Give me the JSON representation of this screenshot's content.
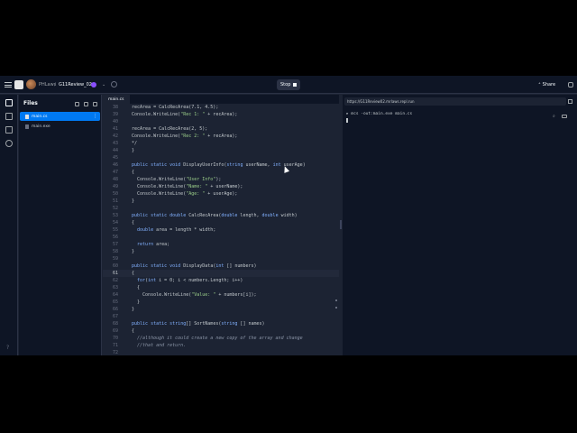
{
  "header": {
    "user": "PHLaws",
    "separator": "/",
    "repl": "G11Review_02",
    "chevron": "⌄",
    "stop_label": "Stop",
    "share_label": "Share",
    "share_icon": "person-plus-icon"
  },
  "files": {
    "title": "Files",
    "items": [
      {
        "name": "main.cs",
        "active": true
      },
      {
        "name": "main.exe",
        "active": false
      }
    ],
    "more": "⋮"
  },
  "editor": {
    "tab": "main.cs",
    "current_line": 61,
    "lines": [
      {
        "n": "38",
        "t": "recArea = CalcRecArea(7.1, 4.5);"
      },
      {
        "n": "39",
        "t": "Console.WriteLine(\"Rec 1: \" + recArea);"
      },
      {
        "n": "40",
        "t": ""
      },
      {
        "n": "41",
        "t": "recArea = CalcRecArea(2, 5);"
      },
      {
        "n": "42",
        "t": "Console.WriteLine(\"Rec 2: \" + recArea);"
      },
      {
        "n": "43",
        "t": "*/"
      },
      {
        "n": "44",
        "t": "}"
      },
      {
        "n": "45",
        "t": ""
      },
      {
        "n": "46",
        "t": "public static void DisplayUserInfo(string userName, int userAge)"
      },
      {
        "n": "47",
        "t": "{"
      },
      {
        "n": "48",
        "t": "  Console.WriteLine(\"User Info\");"
      },
      {
        "n": "49",
        "t": "  Console.WriteLine(\"Name: \" + userName);"
      },
      {
        "n": "50",
        "t": "  Console.WriteLine(\"Age: \" + userAge);"
      },
      {
        "n": "51",
        "t": "}"
      },
      {
        "n": "52",
        "t": ""
      },
      {
        "n": "53",
        "t": "public static double CalcRecArea(double length, double width)"
      },
      {
        "n": "54",
        "t": "{"
      },
      {
        "n": "55",
        "t": "  double area = length * width;"
      },
      {
        "n": "56",
        "t": ""
      },
      {
        "n": "57",
        "t": "  return area;"
      },
      {
        "n": "58",
        "t": "}"
      },
      {
        "n": "59",
        "t": ""
      },
      {
        "n": "60",
        "t": "public static void DisplayData(int [] numbers)"
      },
      {
        "n": "61",
        "t": "{"
      },
      {
        "n": "62",
        "t": "  for(int i = 0; i < numbers.Length; i++)"
      },
      {
        "n": "63",
        "t": "  {"
      },
      {
        "n": "64",
        "t": "    Console.WriteLine(\"Value: \" + numbers[i]);"
      },
      {
        "n": "65",
        "t": "  }"
      },
      {
        "n": "66",
        "t": "}"
      },
      {
        "n": "67",
        "t": ""
      },
      {
        "n": "68",
        "t": "public static string[] SortNames(string [] names)"
      },
      {
        "n": "69",
        "t": "{"
      },
      {
        "n": "70",
        "t": "  //although it could create a new copy of the array and change"
      },
      {
        "n": "71",
        "t": "  //that and return."
      },
      {
        "n": "72",
        "t": ""
      }
    ]
  },
  "console": {
    "url": "https://G11Review02.mrlaws.repl.run",
    "prompt": "▸",
    "command": " mcs -out:main.exe main.cs"
  },
  "colors": {
    "accent": "#0079f2",
    "background": "#1c2333",
    "panel": "#0e1525"
  }
}
